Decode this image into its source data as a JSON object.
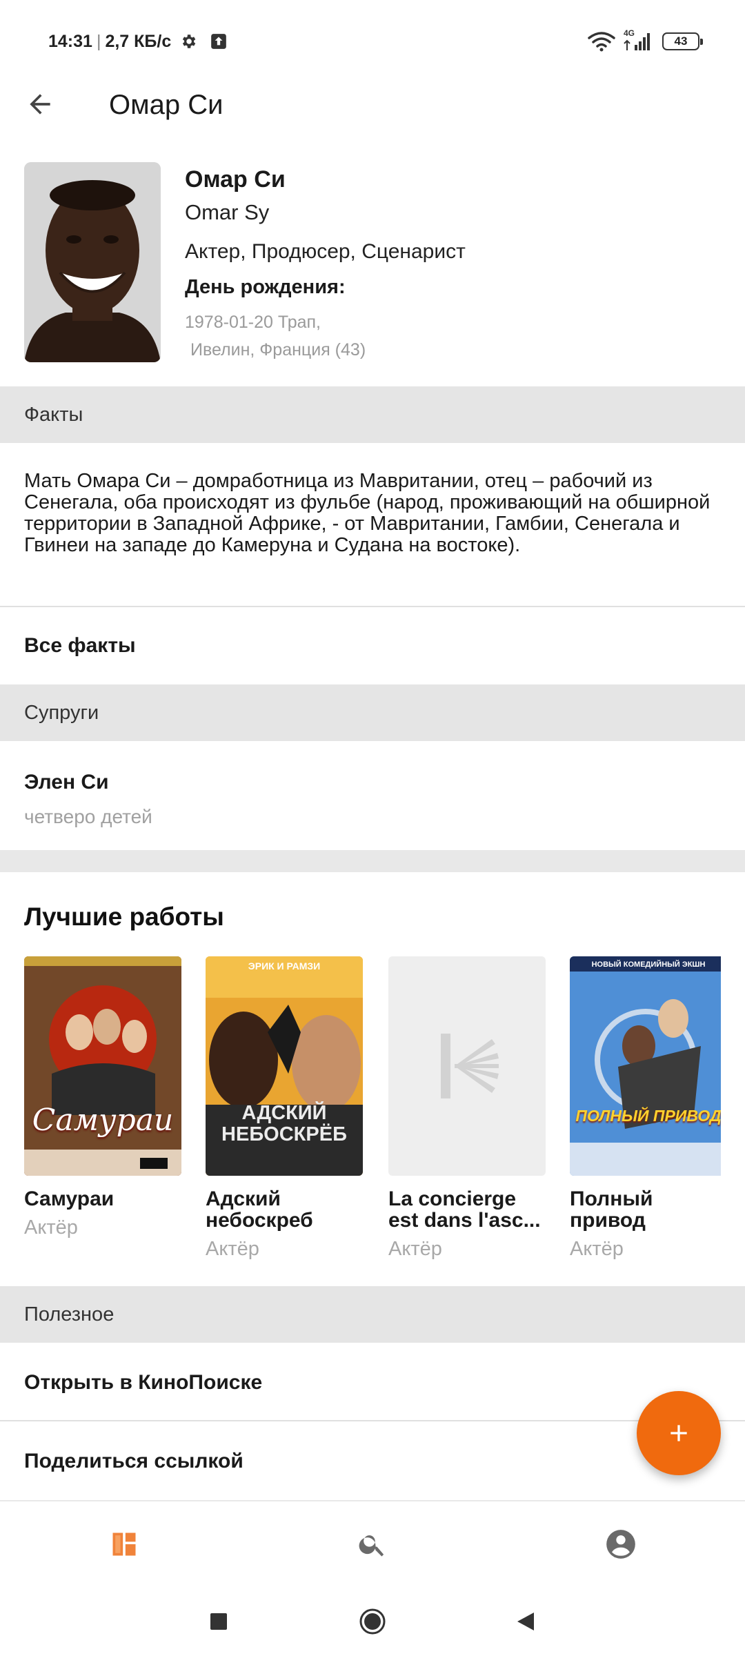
{
  "status_bar": {
    "time": "14:31",
    "speed": "2,7 КБ/с",
    "network": "4G",
    "battery": "43"
  },
  "appbar": {
    "title": "Омар Си"
  },
  "person": {
    "name_ru": "Омар Си",
    "name_en": "Omar Sy",
    "roles": "Актер, Продюсер, Сценарист",
    "birthday_label": "День рождения:",
    "birthday_line1": "1978-01-20 Трап,",
    "birthday_line2": "Ивелин,  Франция  (43)"
  },
  "facts": {
    "header": "Факты",
    "text": "Мать Омара Си – домработница из Мавритании, отец – рабочий из Сенегала, оба происходят из фульбе (народ, проживающий на обширной территории в Западной Африке, - от Мавритании, Гамбии, Сенегала и Гвинеи на западе до Камеруна и Судана на востоке).",
    "all_link": "Все факты"
  },
  "spouses": {
    "header": "Супруги",
    "items": [
      {
        "name": "Элен Си",
        "note": "четверо детей"
      }
    ]
  },
  "best_works": {
    "title": "Лучшие работы",
    "items": [
      {
        "title": "Самураи",
        "role": "Актёр",
        "poster_text": "Самураи"
      },
      {
        "title": "Адский небоскреб",
        "role": "Актёр",
        "poster_text": "АДСКИЙ НЕБОСКРЁБ",
        "poster_top": "ЭРИК И РАМЗИ"
      },
      {
        "title": "La concierge est dans l'asc...",
        "role": "Актёр"
      },
      {
        "title": "Полный привод",
        "role": "Актёр",
        "poster_text": "ПОЛНЫЙ ПРИВОД",
        "poster_top": "НОВЫЙ КОМЕДИЙНЫЙ ЭКШН"
      }
    ]
  },
  "useful": {
    "header": "Полезное",
    "links": [
      "Открыть в КиноПоиске",
      "Поделиться ссылкой"
    ]
  },
  "colors": {
    "accent": "#f06a0e",
    "section_bg": "#e5e5e5",
    "muted_text": "#a0a0a0"
  },
  "icons": {
    "back": "arrow-left-icon",
    "fab": "plus-icon",
    "nav": [
      "dashboard-icon",
      "search-icon",
      "account-icon"
    ],
    "system": [
      "recents-square-icon",
      "home-circle-icon",
      "back-triangle-icon"
    ]
  }
}
